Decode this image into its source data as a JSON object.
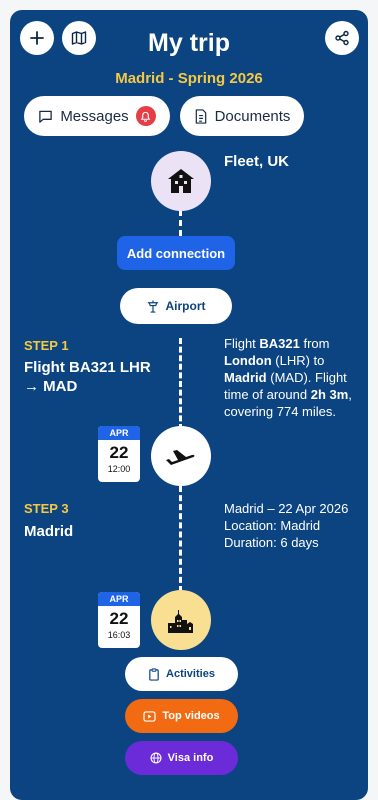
{
  "header": {
    "title": "My trip",
    "subtitle": "Madrid - Spring 2026",
    "add_icon": "plus-icon",
    "map_icon": "map-icon",
    "share_icon": "share-icon"
  },
  "top_buttons": {
    "messages_label": "Messages",
    "documents_label": "Documents",
    "messages_icon": "chat-icon",
    "notification_icon": "bell-icon",
    "documents_icon": "document-icon"
  },
  "origin": {
    "place": "Fleet, UK",
    "icon": "house-icon"
  },
  "add_connection_label": "Add connection",
  "airport_label": "Airport",
  "steps": [
    {
      "label": "STEP 1",
      "title": "Flight BA321 LHR → MAD",
      "desc": {
        "p1": "Flight ",
        "flight": "BA321",
        "p2": " from ",
        "from_city": "London",
        "p3": " (LHR) to ",
        "to_city": "Madrid",
        "p4": " (MAD). Flight time of around ",
        "duration": "2h 3m",
        "p5": ", covering 774 miles."
      },
      "date": {
        "month": "APR",
        "day": "22",
        "time": "12:00"
      },
      "icon": "airplane-icon"
    },
    {
      "label": "STEP 3",
      "title": "Madrid",
      "desc_lines": [
        "Madrid – 22 Apr 2026",
        "Location: Madrid",
        "Duration: 6 days"
      ],
      "date": {
        "month": "APR",
        "day": "22",
        "time": "16:03"
      },
      "icon": "city-icon"
    }
  ],
  "actions": {
    "activities_label": "Activities",
    "top_videos_label": "Top videos",
    "visa_info_label": "Visa info"
  },
  "colors": {
    "panel": "#0b4480",
    "accent_yellow": "#f6c944",
    "primary_blue": "#1f64e6",
    "orange": "#f26b12",
    "purple": "#6c2bd9",
    "badge_red": "#e53e47"
  }
}
